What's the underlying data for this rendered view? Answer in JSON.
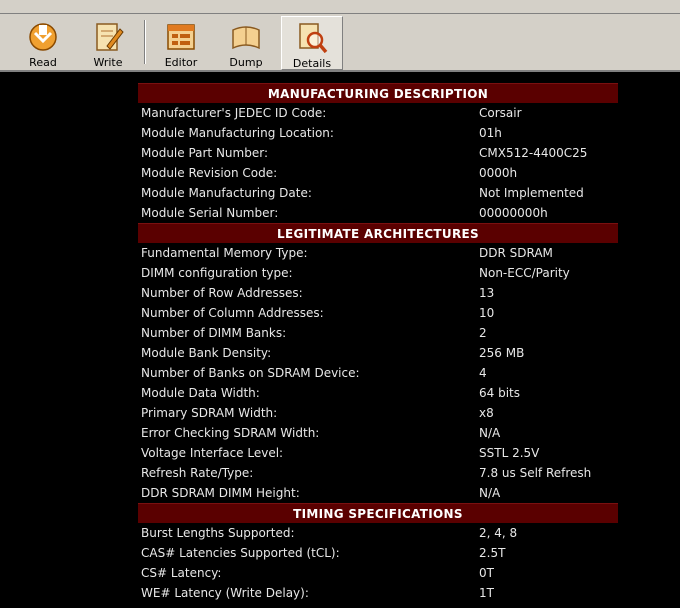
{
  "toolbar": {
    "buttons": [
      {
        "label": "Read",
        "icon": "read-icon"
      },
      {
        "label": "Write",
        "icon": "write-icon"
      },
      {
        "label": "Editor",
        "icon": "editor-icon"
      },
      {
        "label": "Dump",
        "icon": "dump-icon"
      },
      {
        "label": "Details",
        "icon": "details-icon"
      }
    ]
  },
  "sections": [
    {
      "title": "MANUFACTURING DESCRIPTION",
      "rows": [
        {
          "label": "Manufacturer's JEDEC ID Code:",
          "value": "Corsair"
        },
        {
          "label": "Module Manufacturing Location:",
          "value": "01h"
        },
        {
          "label": "Module Part Number:",
          "value": "CMX512-4400C25"
        },
        {
          "label": "Module Revision Code:",
          "value": "0000h"
        },
        {
          "label": "Module Manufacturing Date:",
          "value": "Not Implemented"
        },
        {
          "label": "Module Serial Number:",
          "value": "00000000h"
        }
      ]
    },
    {
      "title": "LEGITIMATE ARCHITECTURES",
      "rows": [
        {
          "label": "Fundamental Memory Type:",
          "value": "DDR SDRAM"
        },
        {
          "label": "DIMM configuration type:",
          "value": "Non-ECC/Parity"
        },
        {
          "label": "Number of Row Addresses:",
          "value": "13"
        },
        {
          "label": "Number of Column Addresses:",
          "value": "10"
        },
        {
          "label": "Number of DIMM Banks:",
          "value": "2"
        },
        {
          "label": "Module Bank Density:",
          "value": "256 MB"
        },
        {
          "label": "Number of Banks on SDRAM Device:",
          "value": "4"
        },
        {
          "label": "Module Data Width:",
          "value": "64 bits"
        },
        {
          "label": "Primary SDRAM Width:",
          "value": "x8"
        },
        {
          "label": "Error Checking SDRAM Width:",
          "value": "N/A"
        },
        {
          "label": "Voltage Interface Level:",
          "value": "SSTL 2.5V"
        },
        {
          "label": "Refresh Rate/Type:",
          "value": "7.8 us Self Refresh"
        },
        {
          "label": "DDR SDRAM DIMM Height:",
          "value": "N/A"
        }
      ]
    },
    {
      "title": "TIMING SPECIFICATIONS",
      "rows": [
        {
          "label": "Burst Lengths Supported:",
          "value": "2, 4, 8"
        },
        {
          "label": "CAS# Latencies Supported (tCL):",
          "value": "2.5T"
        },
        {
          "label": "CS# Latency:",
          "value": "0T"
        },
        {
          "label": "WE# Latency (Write Delay):",
          "value": "1T"
        }
      ]
    }
  ]
}
